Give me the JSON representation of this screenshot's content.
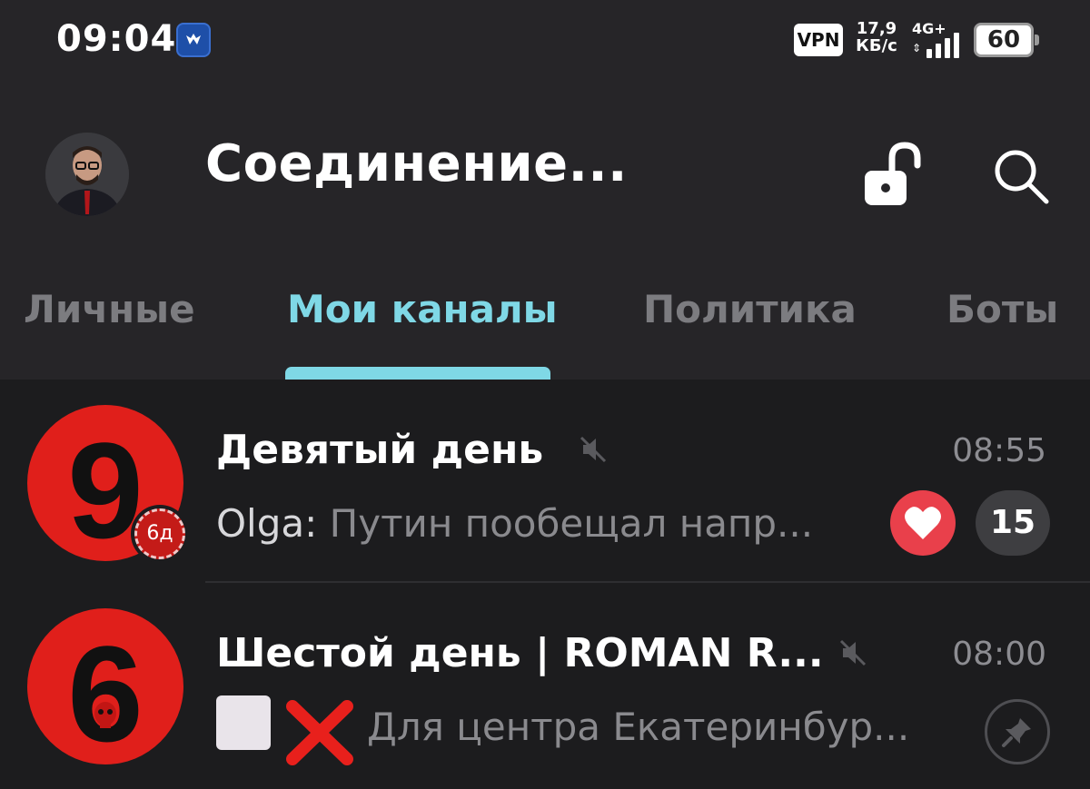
{
  "status_bar": {
    "time": "09:04",
    "vpn": "VPN",
    "net_speed_value": "17,9",
    "net_speed_unit": "КБ/с",
    "network_type": "4G+",
    "battery": "60"
  },
  "header": {
    "title": "Соединение..."
  },
  "tabs": [
    {
      "label": "Личные",
      "active": false
    },
    {
      "label": "Мои каналы",
      "active": true
    },
    {
      "label": "Политика",
      "active": false
    },
    {
      "label": "Боты",
      "active": false
    }
  ],
  "chats": [
    {
      "name": "Девятый день",
      "avatar_text": "9",
      "time": "08:55",
      "sender": "Olga:",
      "preview": "Путин пообещал напр...",
      "story_label": "6д",
      "reaction_icon": "heart-icon",
      "unread_count": "15",
      "muted": true
    },
    {
      "name": "Шестой день | ROMAN R...",
      "avatar_text": "6",
      "time": "08:00",
      "preview": "Для центра Екатеринбур...",
      "muted": true,
      "pinned": true
    }
  ],
  "colors": {
    "accent": "#7fd8e6",
    "avatar_red": "#e01f1b",
    "reaction_red": "#e9404b",
    "background": "#1c1c1e",
    "header_bg": "#262528"
  }
}
